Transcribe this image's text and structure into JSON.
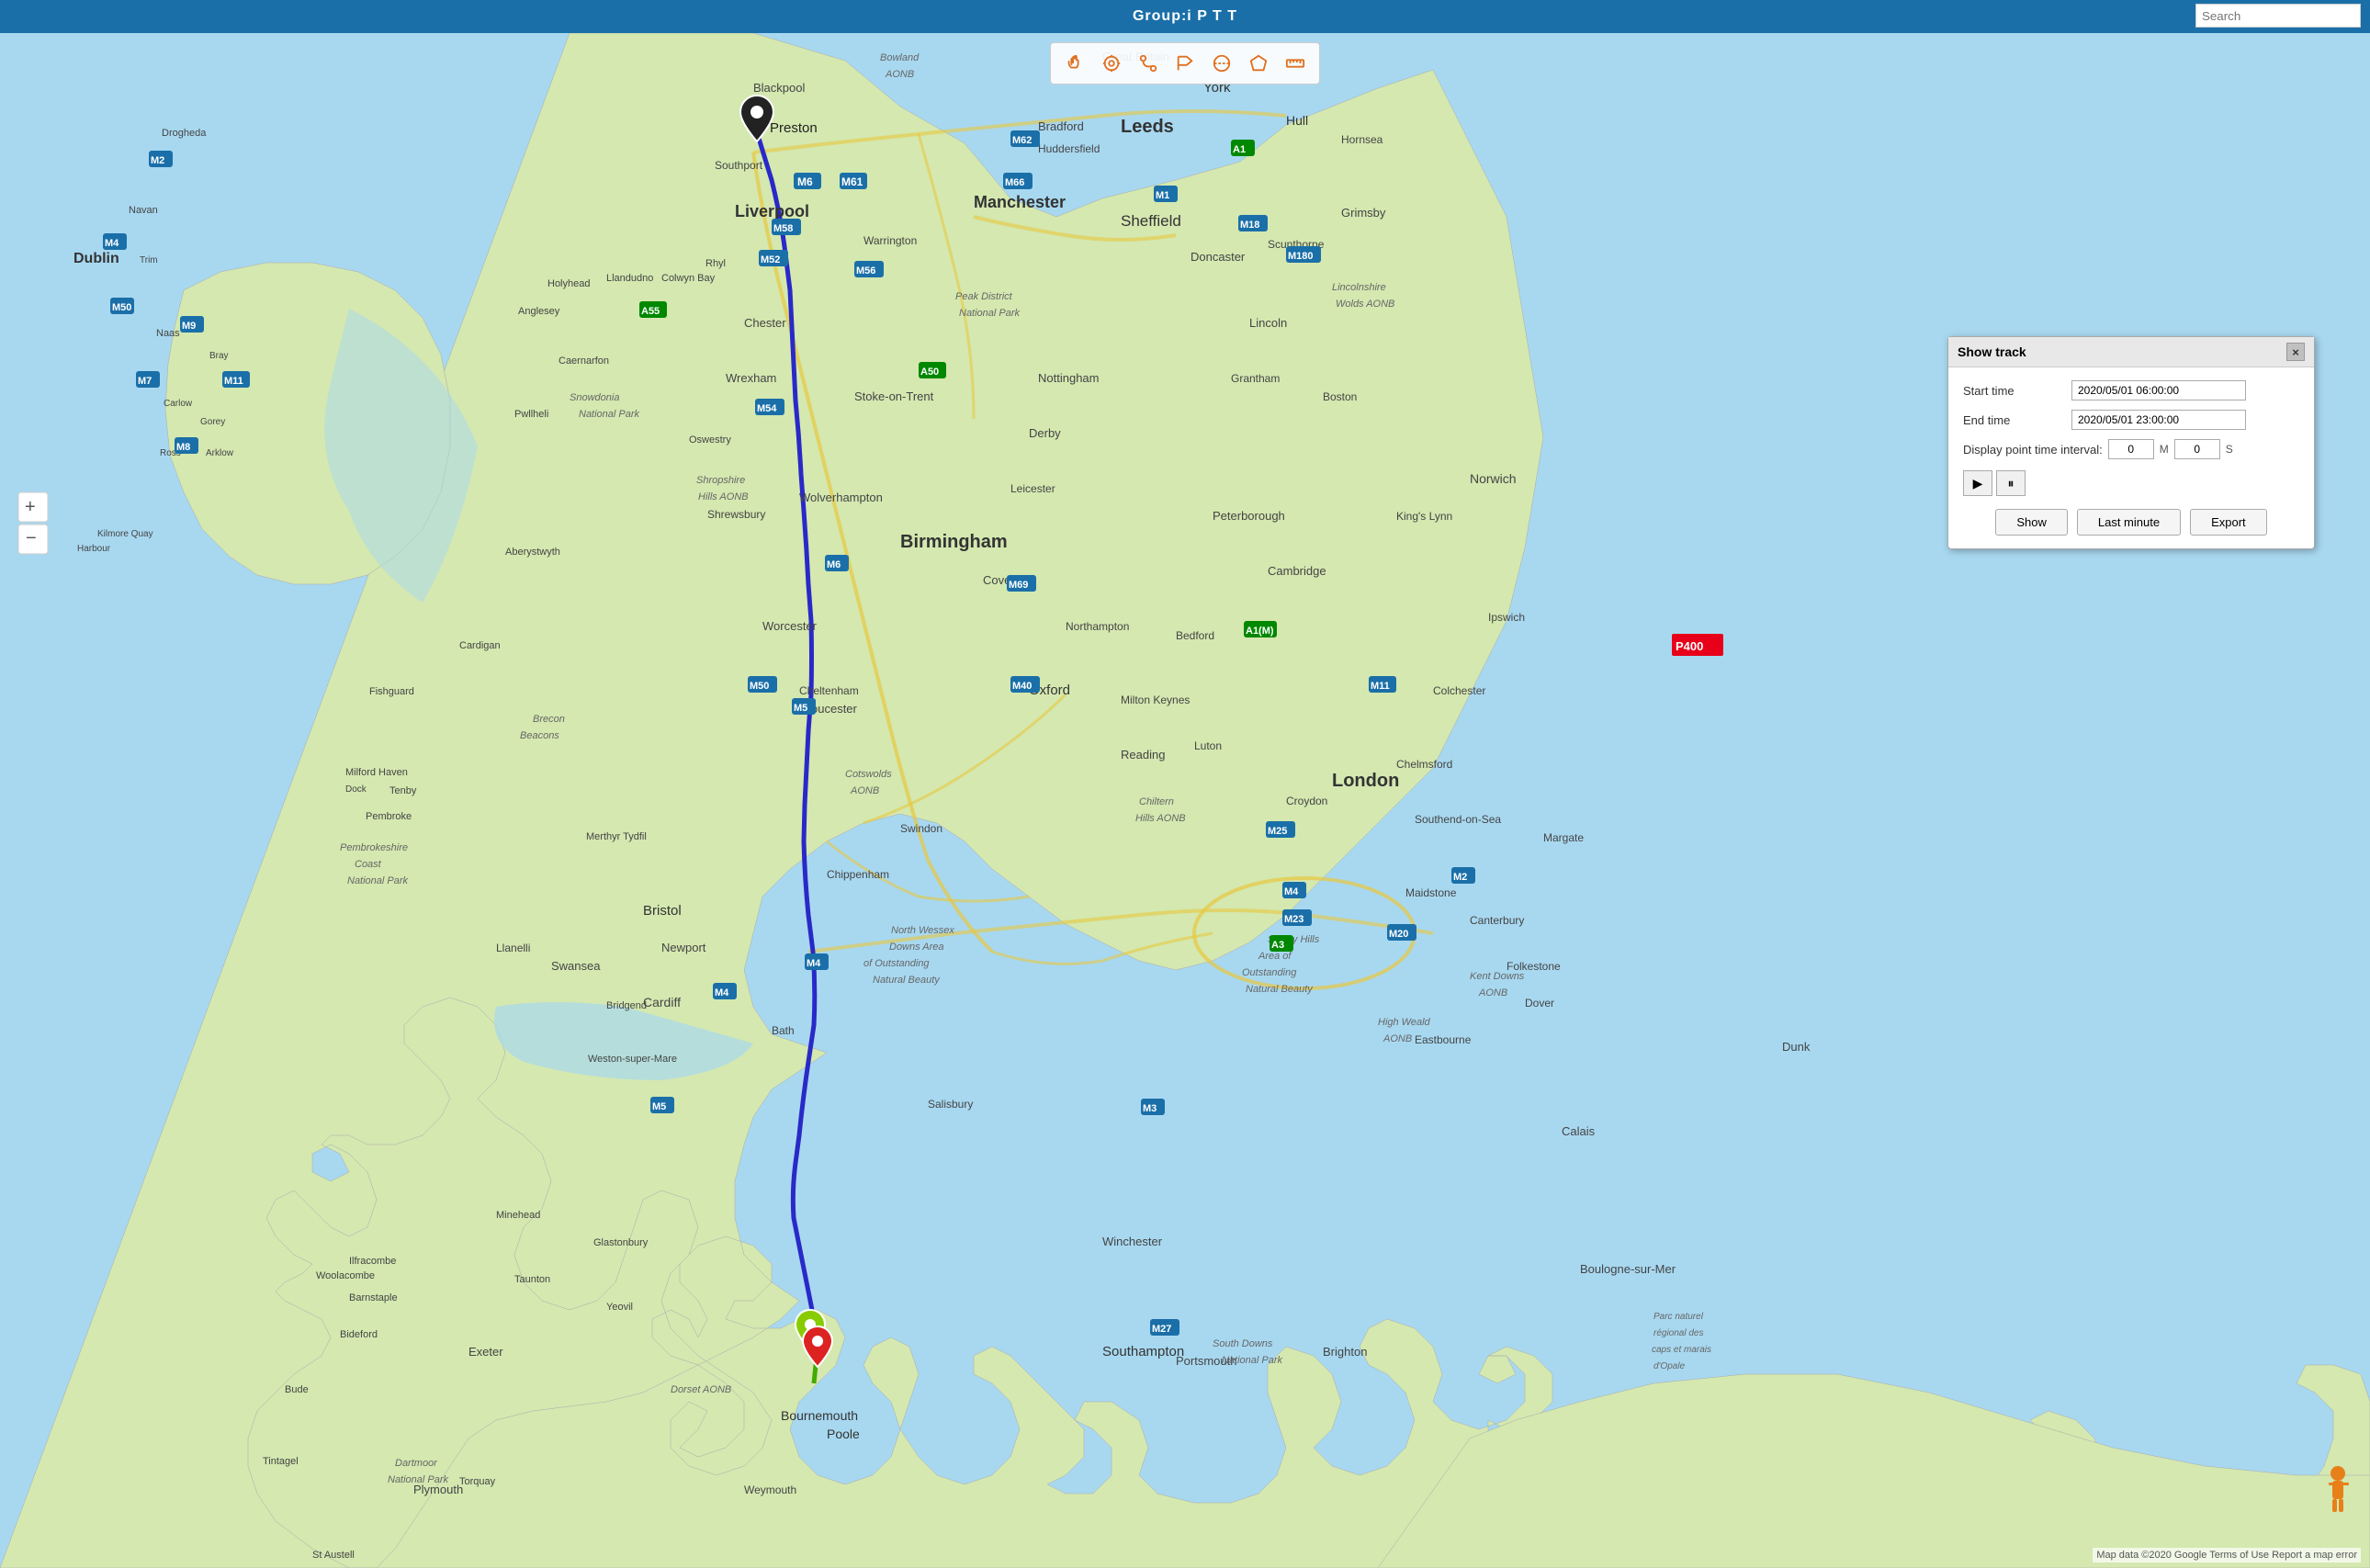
{
  "header": {
    "title": "Group:i P T T",
    "search_placeholder": "Search"
  },
  "toolbar": {
    "tools": [
      {
        "name": "hand-tool",
        "label": "Hand/Pan"
      },
      {
        "name": "target-tool",
        "label": "Target"
      },
      {
        "name": "route-tool",
        "label": "Route"
      },
      {
        "name": "flag-tool",
        "label": "Flag"
      },
      {
        "name": "circle-tool",
        "label": "Circle"
      },
      {
        "name": "polygon-tool",
        "label": "Polygon"
      },
      {
        "name": "measure-tool",
        "label": "Measure"
      }
    ]
  },
  "panel": {
    "title": "Show track",
    "close_label": "×",
    "start_time_label": "Start time",
    "start_time_value": "2020/05/01 06:00:00",
    "end_time_label": "End time",
    "end_time_value": "2020/05/01 23:00:00",
    "interval_label": "Display point time interval:",
    "interval_value": "0",
    "interval_m_label": "M",
    "interval_m_value": "0",
    "interval_s_label": "S",
    "play_label": "▶",
    "pause_label": "⏸",
    "show_btn": "Show",
    "last_minute_btn": "Last minute",
    "export_btn": "Export"
  },
  "map": {
    "route_color": "#2929c8",
    "start_marker_color": "#222222",
    "end_marker_color_1": "#dd2222",
    "end_marker_color_2": "#88cc00",
    "attribution": "Map data ©2020 Google  Terms of Use  Report a map error"
  },
  "road_badge": {
    "label": "P400",
    "color": "#e8001a"
  }
}
